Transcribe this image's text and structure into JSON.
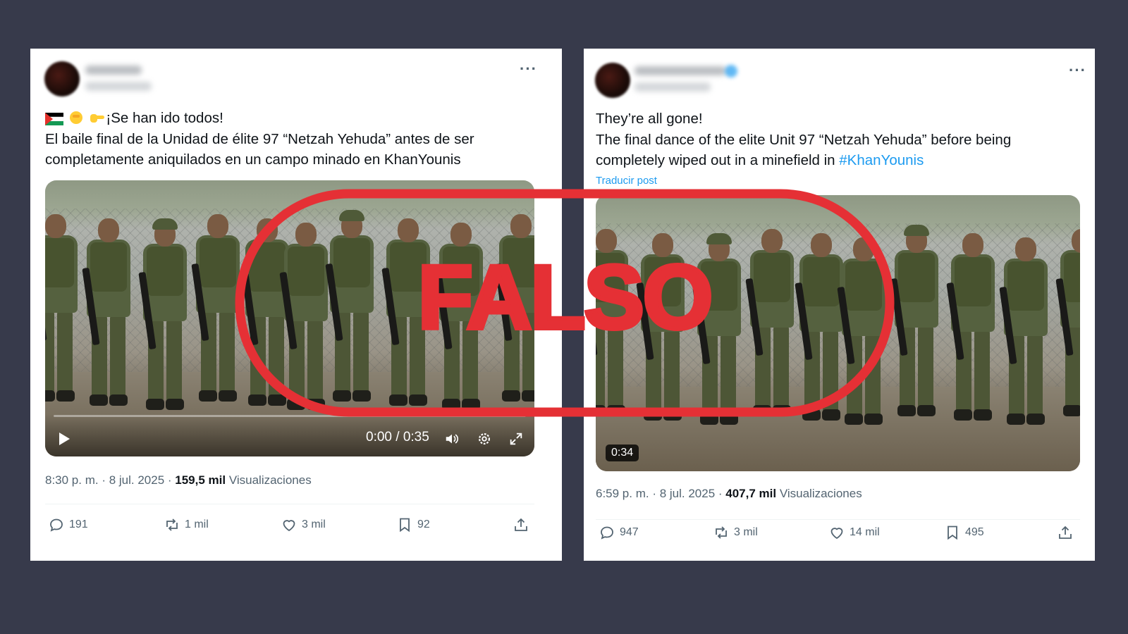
{
  "colors": {
    "background": "#373a4b",
    "stamp_red": "#e53035",
    "link_blue": "#1d9bf0",
    "meta_gray": "#536471"
  },
  "stamp": {
    "text": "FALSO"
  },
  "left_post": {
    "flag_icon": "palestine-flag-icon",
    "text_lines": [
      "¡Se han ido todos!",
      "El baile final de la Unidad de élite 97 “Netzah Yehuda” antes de ser",
      "completamente aniquilados en un campo minado en KhanYounis"
    ],
    "video": {
      "time": "0:00 / 0:35",
      "progress": 0.0
    },
    "timestamp": "8:30 p. m. · 8 jul. 2025 · ",
    "views_count": "159,5 mil",
    "views_label": "Visualizaciones",
    "replies": "191",
    "reposts": "1 mil",
    "likes": "3 mil",
    "bookmarks": "92"
  },
  "right_post": {
    "text_lines": [
      "They’re all gone!",
      "The final dance of the elite Unit 97 “Netzah Yehuda” before being"
    ],
    "text_line3_prefix": "completely wiped out in a minefield in ",
    "hashtag": "#KhanYounis",
    "translate": "Traducir post",
    "video": {
      "duration": "0:34"
    },
    "timestamp": "6:59 p. m. · 8 jul. 2025 · ",
    "views_count": "407,7 mil",
    "views_label": "Visualizaciones",
    "replies": "947",
    "reposts": "3 mil",
    "likes": "14 mil",
    "bookmarks": "495"
  }
}
